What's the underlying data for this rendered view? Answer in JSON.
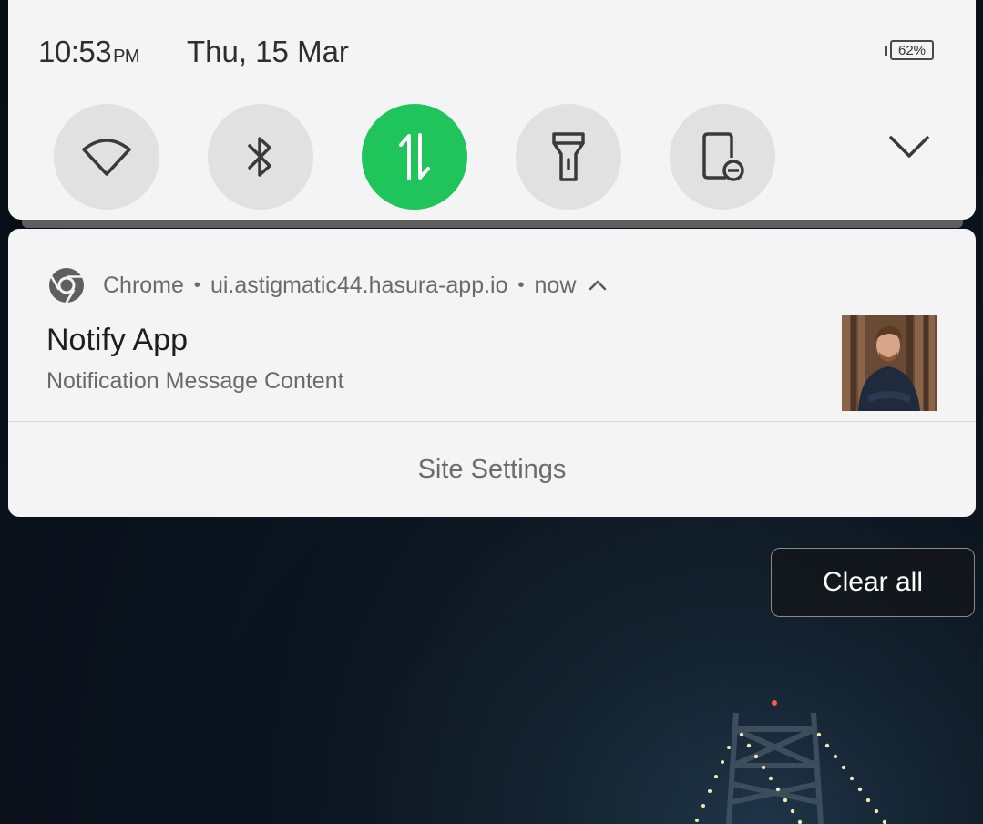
{
  "status_bar": {
    "time": "10:53",
    "ampm": "PM",
    "date": "Thu, 15 Mar",
    "battery": "62%"
  },
  "quick_settings": {
    "tiles": [
      {
        "name": "wifi",
        "icon": "wifi-icon",
        "active": false
      },
      {
        "name": "bluetooth",
        "icon": "bluetooth-icon",
        "active": false
      },
      {
        "name": "mobile-data",
        "icon": "data-transfer-icon",
        "active": true
      },
      {
        "name": "flashlight",
        "icon": "flashlight-icon",
        "active": false
      },
      {
        "name": "screen-rotation-lock",
        "icon": "portrait-lock-icon",
        "active": false
      }
    ],
    "expand_icon": "chevron-down-icon",
    "active_color": "#1fc45a"
  },
  "notification": {
    "app_name": "Chrome",
    "separator": "•",
    "source": "ui.astigmatic44.hasura-app.io",
    "time": "now",
    "title": "Notify App",
    "text": "Notification Message Content",
    "action": "Site Settings",
    "collapse_icon": "chevron-up-icon"
  },
  "clear_all_label": "Clear all"
}
